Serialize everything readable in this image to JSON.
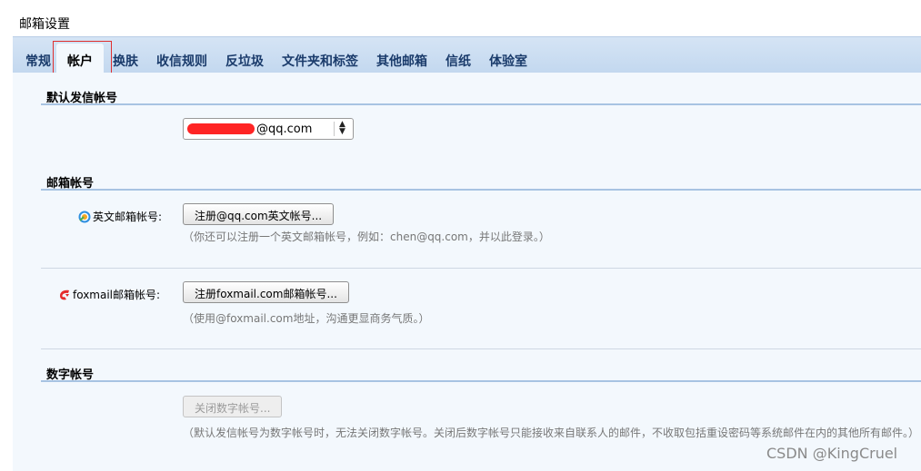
{
  "page_title": "邮箱设置",
  "tabs": [
    {
      "label": "常规",
      "active": false
    },
    {
      "label": "帐户",
      "active": true
    },
    {
      "label": "换肤",
      "active": false
    },
    {
      "label": "收信规则",
      "active": false
    },
    {
      "label": "反垃圾",
      "active": false
    },
    {
      "label": "文件夹和标签",
      "active": false
    },
    {
      "label": "其他邮箱",
      "active": false
    },
    {
      "label": "信纸",
      "active": false
    },
    {
      "label": "体验室",
      "active": false
    }
  ],
  "default_sender": {
    "title": "默认发信帐号",
    "selected_value": "@qq.com"
  },
  "mail_accounts": {
    "title": "邮箱帐号",
    "english": {
      "label": "英文邮箱帐号:",
      "button": "注册@qq.com英文帐号...",
      "hint": "（你还可以注册一个英文邮箱帐号，例如：chen@qq.com，并以此登录。）"
    },
    "foxmail": {
      "label": "foxmail邮箱帐号:",
      "button": "注册foxmail.com邮箱帐号...",
      "hint": "（使用@foxmail.com地址，沟通更显商务气质。）"
    }
  },
  "digital_account": {
    "title": "数字帐号",
    "button": "关闭数字帐号...",
    "hint": "（默认发信帐号为数字帐号时，无法关闭数字帐号。关闭后数字帐号只能接收来自联系人的邮件，不收取包括重设密码等系统邮件在内的其他所有邮件。）"
  },
  "watermark": "CSDN @KingCruel",
  "colors": {
    "tab_bar": "#c9dcf1",
    "content_bg": "#f3f8fd",
    "section_rule": "#a7c3e2",
    "highlight": "#e03030",
    "redaction": "#ff2424"
  }
}
